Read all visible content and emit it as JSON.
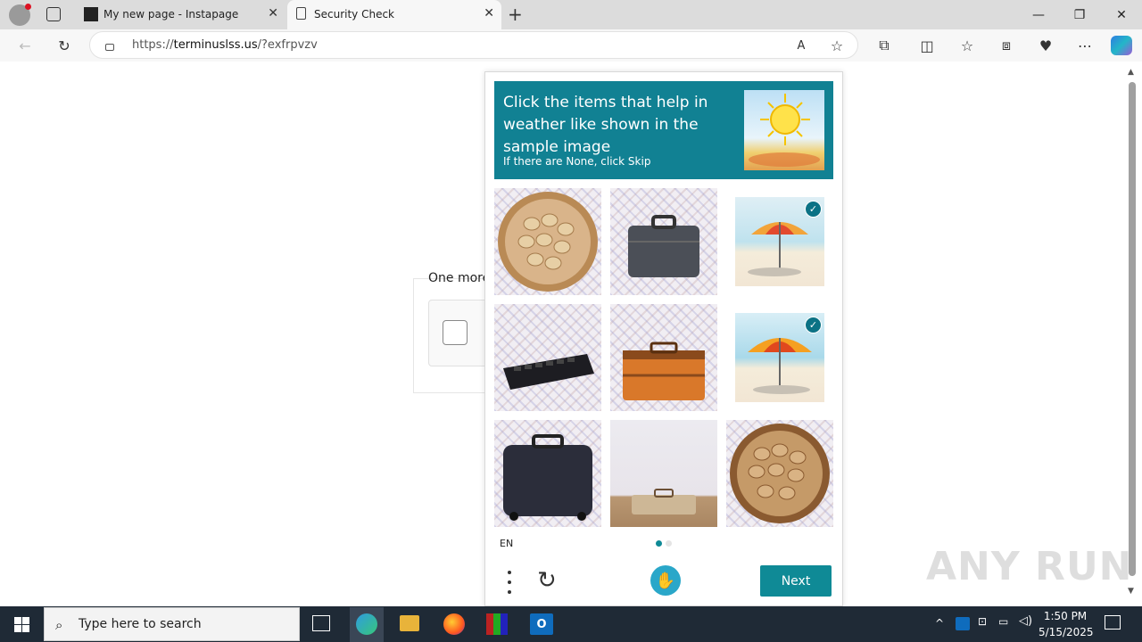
{
  "browser": {
    "tabs": [
      {
        "title": "My new page - Instapage"
      },
      {
        "title": "Security Check"
      }
    ],
    "url": {
      "host": "terminuslss.us",
      "path": "/?exfrpvzv",
      "prefix": "https://"
    }
  },
  "underlying": {
    "text": "One more"
  },
  "captcha": {
    "prompt_title": "Click the items that help in weather like shown in the sample image",
    "prompt_sub": "If there are None, click Skip",
    "items": [
      {
        "label": "basket-of-nuts",
        "selected": false
      },
      {
        "label": "briefcase",
        "selected": false
      },
      {
        "label": "beach-umbrella",
        "selected": true
      },
      {
        "label": "keyboard",
        "selected": false
      },
      {
        "label": "suitcase",
        "selected": false
      },
      {
        "label": "beach-umbrella",
        "selected": true
      },
      {
        "label": "luggage",
        "selected": false
      },
      {
        "label": "suitcase",
        "selected": false
      },
      {
        "label": "basket-of-nuts",
        "selected": false
      }
    ],
    "lang": "EN",
    "next_label": "Next",
    "accent": "#118193"
  },
  "taskbar": {
    "search_placeholder": "Type here to search",
    "time": "1:50 PM",
    "date": "5/15/2025"
  },
  "watermark": "ANY RUN"
}
